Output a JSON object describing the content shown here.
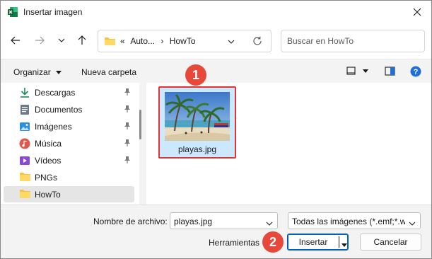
{
  "window": {
    "title": "Insertar imagen",
    "app_icon": "excel-icon"
  },
  "address": {
    "overflow": "«",
    "crumbs": [
      "Auto...",
      "HowTo"
    ],
    "search_placeholder": "Buscar en HowTo"
  },
  "toolbar": {
    "organize_label": "Organizar",
    "new_folder_label": "Nueva carpeta"
  },
  "sidebar": {
    "items": [
      {
        "label": "Descargas",
        "icon": "download-icon",
        "pinned": true,
        "selected": false
      },
      {
        "label": "Documentos",
        "icon": "documents-icon",
        "pinned": true,
        "selected": false
      },
      {
        "label": "Imágenes",
        "icon": "pictures-icon",
        "pinned": true,
        "selected": false
      },
      {
        "label": "Música",
        "icon": "music-icon",
        "pinned": true,
        "selected": false
      },
      {
        "label": "Vídeos",
        "icon": "videos-icon",
        "pinned": true,
        "selected": false
      },
      {
        "label": "PNGs",
        "icon": "folder-icon",
        "pinned": false,
        "selected": false
      },
      {
        "label": "HowTo",
        "icon": "folder-icon",
        "pinned": false,
        "selected": true
      }
    ]
  },
  "files": [
    {
      "name": "playas.jpg",
      "selected": true
    }
  ],
  "annotations": {
    "step1": "1",
    "step2": "2"
  },
  "footer": {
    "filename_label": "Nombre de archivo:",
    "filename_value": "playas.jpg",
    "filetype_value": "Todas las imágenes (*.emf;*.wmf",
    "tools_label": "Herramientas",
    "insert_label": "Insertar",
    "cancel_label": "Cancelar"
  },
  "colors": {
    "accent": "#005fb8",
    "annotation": "#e8483a",
    "selection": "#cce8ff"
  }
}
